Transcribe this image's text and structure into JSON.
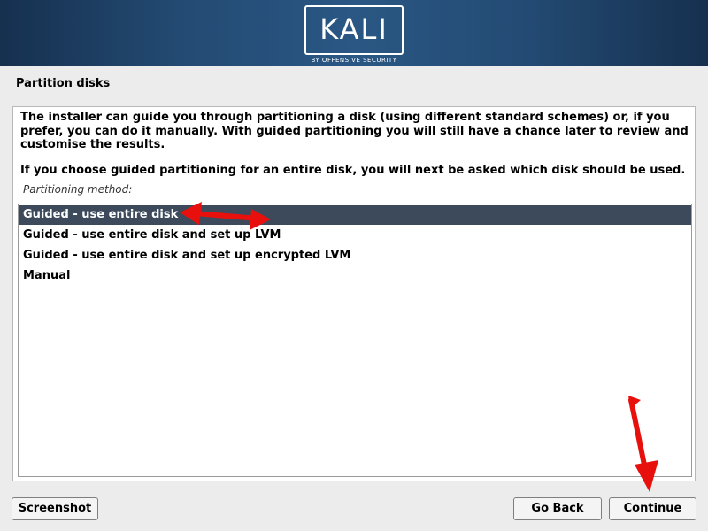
{
  "banner": {
    "logo_text": "KALI",
    "logo_subtitle": "BY OFFENSIVE SECURITY"
  },
  "page": {
    "title": "Partition disks"
  },
  "content": {
    "description_1": "The installer can guide you through partitioning a disk (using different standard schemes) or, if you prefer, you can do it manually. With guided partitioning you will still have a chance later to review and customise the results.",
    "description_2": "If you choose guided partitioning for an entire disk, you will next be asked which disk should be used.",
    "method_label": "Partitioning method:",
    "options": [
      {
        "label": "Guided - use entire disk",
        "selected": true
      },
      {
        "label": "Guided - use entire disk and set up LVM",
        "selected": false
      },
      {
        "label": "Guided - use entire disk and set up encrypted LVM",
        "selected": false
      },
      {
        "label": "Manual",
        "selected": false
      }
    ]
  },
  "buttons": {
    "screenshot": "Screenshot",
    "go_back": "Go Back",
    "continue": "Continue"
  },
  "colors": {
    "selection": "#3c4a5c",
    "annotation_arrow": "#e8100c"
  },
  "annotations": {
    "arrow_icon_1": "double-arrow-icon",
    "arrow_icon_2": "arrow-icon"
  }
}
